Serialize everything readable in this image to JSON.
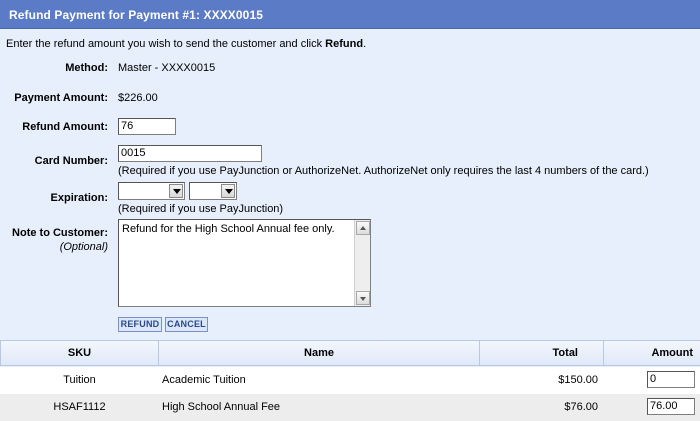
{
  "header": {
    "title": "Refund Payment for Payment #1: XXXX0015"
  },
  "intro": {
    "text": "Enter the refund amount you wish to send the customer and click ",
    "bold": "Refund",
    "end": "."
  },
  "form": {
    "method_label": "Method:",
    "method_value": "Master - XXXX0015",
    "payment_amount_label": "Payment Amount:",
    "payment_amount_value": "$226.00",
    "refund_amount_label": "Refund Amount:",
    "refund_amount_value": "76",
    "card_number_label": "Card Number:",
    "card_number_value": "0015",
    "card_number_hint": "(Required if you use PayJunction or AuthorizeNet. AuthorizeNet only requires the last 4 numbers of the card.)",
    "expiration_label": "Expiration:",
    "expiration_month": "",
    "expiration_year": "",
    "expiration_hint": "(Required if you use PayJunction)",
    "note_label": "Note to Customer:",
    "note_optional": "(Optional)",
    "note_value": "Refund for the High School Annual fee only."
  },
  "buttons": {
    "refund": "REFUND",
    "cancel": "CANCEL"
  },
  "table": {
    "headers": {
      "sku": "SKU",
      "name": "Name",
      "total": "Total",
      "amount": "Amount"
    },
    "rows": [
      {
        "sku": "Tuition",
        "name": "Academic Tuition",
        "total": "$150.00",
        "amount": "0"
      },
      {
        "sku": "HSAF1112",
        "name": "High School Annual Fee",
        "total": "$76.00",
        "amount": "76.00"
      }
    ]
  }
}
